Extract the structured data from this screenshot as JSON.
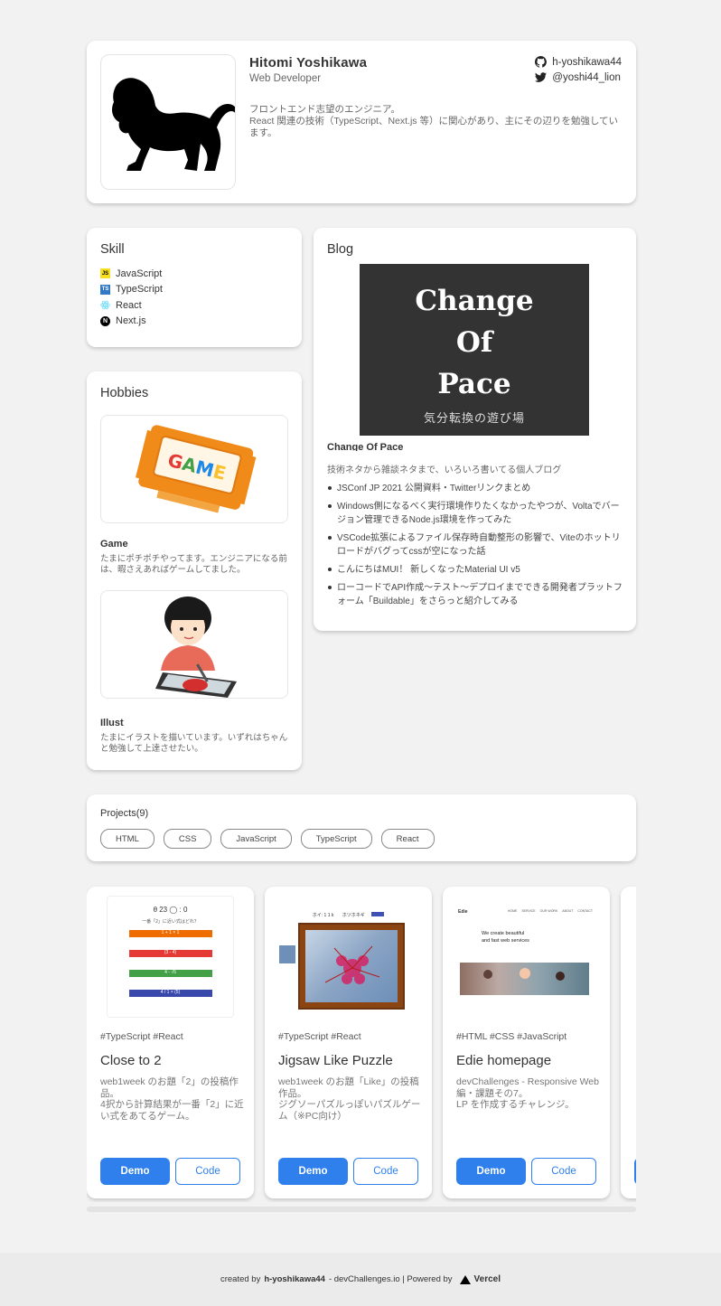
{
  "profile": {
    "name": "Hitomi Yoshikawa",
    "role": "Web Developer",
    "github": "h-yoshikawa44",
    "twitter": "@yoshi44_lion",
    "bio_line1": "フロントエンド志望のエンジニア。",
    "bio_line2": "React 関連の技術（TypeScript、Next.js 等）に関心があり、主にその辺りを勉強しています。"
  },
  "skill": {
    "title": "Skill",
    "items": [
      {
        "label": "JavaScript",
        "icon": "javascript-icon",
        "color": "#f7df1e"
      },
      {
        "label": "TypeScript",
        "icon": "typescript-icon",
        "color": "#3178c6"
      },
      {
        "label": "React",
        "icon": "react-icon",
        "color": "#61dafb"
      },
      {
        "label": "Next.js",
        "icon": "nextjs-icon",
        "color": "#000000"
      }
    ]
  },
  "hobbies": {
    "title": "Hobbies",
    "items": [
      {
        "title": "Game",
        "desc": "たまにポチポチやってます。エンジニアになる前は、暇さえあればゲームしてました。"
      },
      {
        "title": "Illust",
        "desc": "たまにイラストを描いています。いずれはちゃんと勉強して上達させたい。"
      }
    ]
  },
  "blog": {
    "title": "Blog",
    "image_title_1": "Change",
    "image_title_2": "Of",
    "image_title_3": "Pace",
    "image_subtitle": "気分転換の遊び場",
    "name": "Change Of Pace",
    "desc": "技術ネタから雑談ネタまで、いろいろ書いてる個人ブログ",
    "posts": [
      "JSConf JP 2021 公開資料・Twitterリンクまとめ",
      "Windows側になるべく実行環境作りたくなかったやつが、Voltaでバージョン管理できるNode.js環境を作ってみた",
      "VSCode拡張によるファイル保存時自動整形の影響で、Viteのホットリロードがバグってcssが空になった話",
      "こんにちはMUI！ 新しくなったMaterial UI v5",
      "ローコードでAPI作成〜テスト〜デプロイまでできる開発者プラットフォーム「Buildable」をさらっと紹介してみる"
    ]
  },
  "projects": {
    "title": "Projects(9)",
    "tags": [
      "HTML",
      "CSS",
      "JavaScript",
      "TypeScript",
      "React"
    ],
    "cards": [
      {
        "tags": "#TypeScript  #React",
        "name": "Close to 2",
        "desc": "web1week のお題「2」の投稿作品。\n4択から計算結果が一番「2」に近い式をあてるゲーム。",
        "demo": "Demo",
        "code": "Code"
      },
      {
        "tags": "#TypeScript  #React",
        "name": "Jigsaw Like Puzzle",
        "desc": "web1week のお題「Like」の投稿作品。\nジグソーパズルっぽいパズルゲーム（※PC向け）",
        "demo": "Demo",
        "code": "Code"
      },
      {
        "tags": "#HTML  #CSS  #JavaScript",
        "name": "Edie homepage",
        "desc": "devChallenges - Responsive Web 編・課題その7。\nLP を作成するチャレンジ。",
        "demo": "Demo",
        "code": "Code"
      }
    ],
    "shot1": {
      "score": "θ 23  ◯ : 0",
      "question": "一番「2」に近い式はどれ？",
      "answers": [
        "1 + 1 × 1",
        "(3 - 4)",
        "4 - √5",
        "4 / 1 × (5)"
      ]
    },
    "shot2": {
      "tab1": "ホイ: 1 1 k",
      "tab2": "ホツホネギ"
    },
    "shot3": {
      "logo": "Edie",
      "headline1": "We create beautiful",
      "headline2": "and fast web services",
      "nav": [
        "HOME",
        "SERVICE",
        "OUR WORK",
        "ABOUT",
        "CONTACT"
      ]
    }
  },
  "footer": {
    "created_by": "created by",
    "author": "h-yoshikawa44",
    "site": "- devChallenges.io | Powered by",
    "vercel": "Vercel"
  },
  "colors": {
    "accent": "#2f80ed",
    "background": "#f2f2f2",
    "card": "#ffffff"
  }
}
